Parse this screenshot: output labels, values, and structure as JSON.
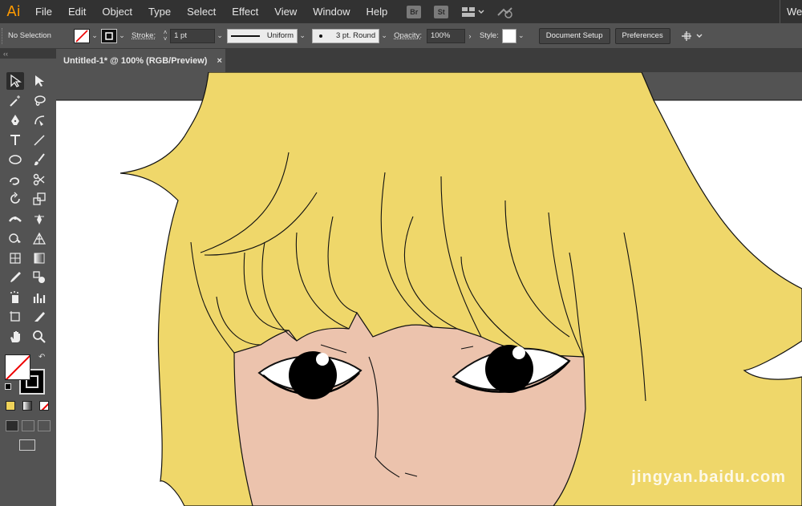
{
  "app": {
    "logo": "Ai",
    "workspace": "Web"
  },
  "menus": [
    "File",
    "Edit",
    "Object",
    "Type",
    "Select",
    "Effect",
    "View",
    "Window",
    "Help"
  ],
  "app_buttons": {
    "bridge": "Br",
    "stock": "St"
  },
  "control": {
    "selection": "No Selection",
    "stroke_label": "Stroke:",
    "stroke_value": "1 pt",
    "profile": "Uniform",
    "brush": "3 pt. Round",
    "opacity_label": "Opacity:",
    "opacity_value": "100%",
    "style_label": "Style:",
    "doc_setup": "Document Setup",
    "preferences": "Preferences"
  },
  "document": {
    "tab_title": "Untitled-1* @ 100% (RGB/Preview)",
    "close": "×"
  },
  "panel_handle": "‹‹",
  "watermark": "jingyan.baidu.com",
  "colors": {
    "hair": "#efd76a",
    "skin": "#ecc3ad",
    "artboard": "#ffffff",
    "chrome": "#535353"
  },
  "tools": [
    "selection-tool-icon",
    "direct-selection-tool-icon",
    "magic-wand-tool-icon",
    "lasso-tool-icon",
    "pen-tool-icon",
    "curvature-tool-icon",
    "type-tool-icon",
    "line-segment-tool-icon",
    "ellipse-tool-icon",
    "paintbrush-tool-icon",
    "shaper-tool-icon",
    "scissors-tool-icon",
    "rotate-tool-icon",
    "scale-tool-icon",
    "width-tool-icon",
    "puppet-warp-tool-icon",
    "shape-builder-tool-icon",
    "perspective-grid-tool-icon",
    "mesh-tool-icon",
    "gradient-tool-icon",
    "eyedropper-tool-icon",
    "blend-tool-icon",
    "symbol-sprayer-tool-icon",
    "column-graph-tool-icon",
    "artboard-tool-icon",
    "slice-tool-icon",
    "hand-tool-icon",
    "zoom-tool-icon"
  ]
}
